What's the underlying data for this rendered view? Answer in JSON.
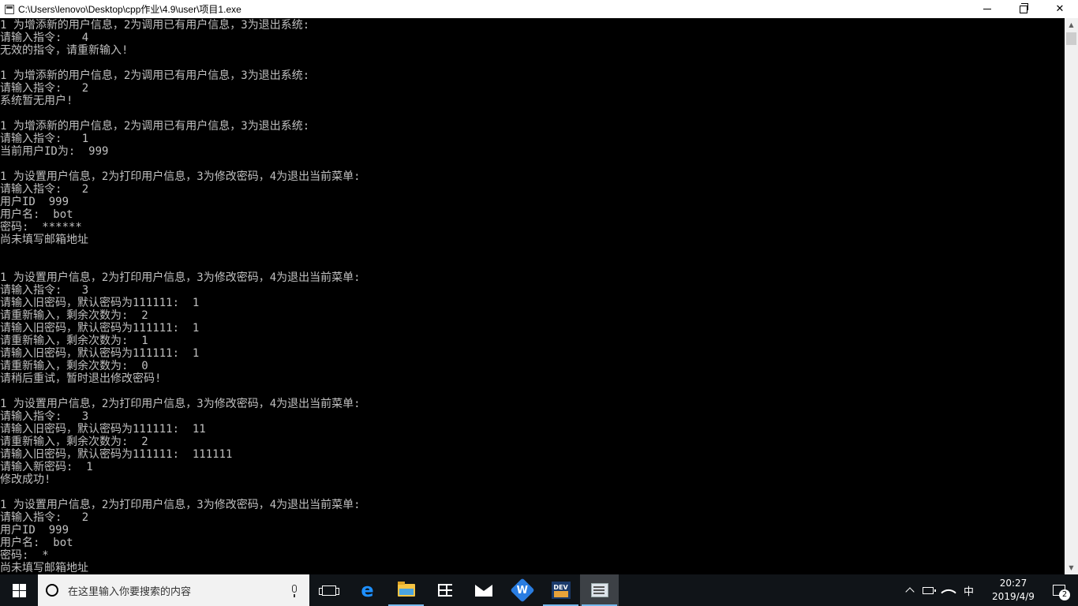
{
  "window": {
    "title": "C:\\Users\\lenovo\\Desktop\\cpp作业\\4.9\\user\\项目1.exe",
    "icon": "console-app-icon"
  },
  "console": {
    "lines": [
      "1 为增添新的用户信息，2为调用已有用户信息，3为退出系统:",
      "请输入指令:   4",
      "无效的指令，请重新输入!",
      "",
      "1 为增添新的用户信息，2为调用已有用户信息，3为退出系统:",
      "请输入指令:   2",
      "系统暂无用户!",
      "",
      "1 为增添新的用户信息，2为调用已有用户信息，3为退出系统:",
      "请输入指令:   1",
      "当前用户ID为:  999",
      "",
      "1 为设置用户信息，2为打印用户信息，3为修改密码，4为退出当前菜单:",
      "请输入指令:   2",
      "用户ID  999",
      "用户名:  bot",
      "密码:  ******",
      "尚未填写邮箱地址",
      "",
      "",
      "1 为设置用户信息，2为打印用户信息，3为修改密码，4为退出当前菜单:",
      "请输入指令:   3",
      "请输入旧密码，默认密码为111111:  1",
      "请重新输入，剩余次数为:  2",
      "请输入旧密码，默认密码为111111:  1",
      "请重新输入，剩余次数为:  1",
      "请输入旧密码，默认密码为111111:  1",
      "请重新输入，剩余次数为:  0",
      "请稍后重试，暂时退出修改密码!",
      "",
      "1 为设置用户信息，2为打印用户信息，3为修改密码，4为退出当前菜单:",
      "请输入指令:   3",
      "请输入旧密码，默认密码为111111:  11",
      "请重新输入，剩余次数为:  2",
      "请输入旧密码，默认密码为111111:  111111",
      "请输入新密码:  1",
      "修改成功!",
      "",
      "1 为设置用户信息，2为打印用户信息，3为修改密码，4为退出当前菜单:",
      "请输入指令:   2",
      "用户ID  999",
      "用户名:  bot",
      "密码:  *",
      "尚未填写邮箱地址"
    ],
    "text_color": "#c0c0c0",
    "background": "#000000"
  },
  "taskbar": {
    "search_placeholder": "在这里输入你要搜索的内容",
    "apps": [
      "task-view",
      "edge",
      "file-explorer",
      "store",
      "mail",
      "wps",
      "dev-cpp",
      "console"
    ],
    "tray": {
      "ime": "中",
      "time": "20:27",
      "date": "2019/4/9",
      "notifications": "2"
    },
    "accent": "#76b9ed"
  }
}
